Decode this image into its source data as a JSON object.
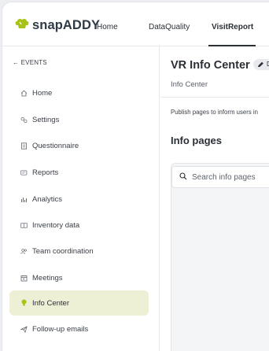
{
  "header": {
    "logo_text": "snapADDY",
    "nav": [
      {
        "label": "Home"
      },
      {
        "label": "DataQuality"
      },
      {
        "label": "VisitReport"
      }
    ],
    "accent": "#a8c21a"
  },
  "sidebar": {
    "back_label": "← EVENTS",
    "items": [
      {
        "label": "Home",
        "icon": "house-icon"
      },
      {
        "label": "Settings",
        "icon": "gears-icon"
      },
      {
        "label": "Questionnaire",
        "icon": "document-icon"
      },
      {
        "label": "Reports",
        "icon": "report-icon"
      },
      {
        "label": "Analytics",
        "icon": "bar-chart-icon"
      },
      {
        "label": "Inventory data",
        "icon": "book-icon"
      },
      {
        "label": "Team coordination",
        "icon": "team-icon"
      },
      {
        "label": "Meetings",
        "icon": "calendar-icon"
      },
      {
        "label": "Info Center",
        "icon": "lightbulb-icon"
      },
      {
        "label": "Follow-up emails",
        "icon": "paper-plane-icon"
      }
    ],
    "active_color": "#eef0d6"
  },
  "main": {
    "title": "VR Info Center",
    "edit_label": "D",
    "subtitle": "Info Center",
    "description": "Publish pages to inform users in",
    "section_title": "Info pages",
    "search_placeholder": "Search info pages"
  }
}
